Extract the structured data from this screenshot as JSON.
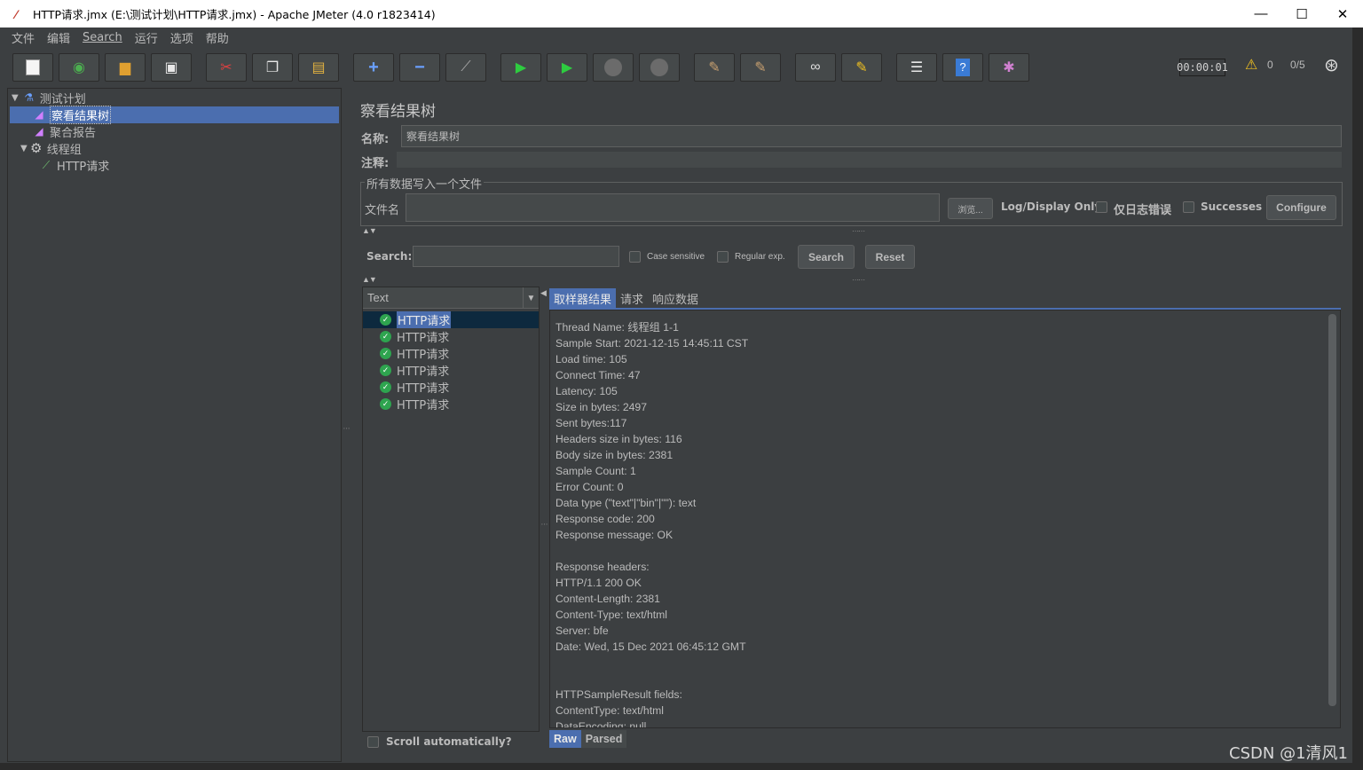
{
  "window": {
    "title": "HTTP请求.jmx (E:\\测试计划\\HTTP请求.jmx) - Apache JMeter (4.0 r1823414)",
    "min": "—",
    "max": "☐",
    "close": "✕"
  },
  "menu": [
    "文件",
    "编辑",
    "Search",
    "运行",
    "选项",
    "帮助"
  ],
  "toolbar": {
    "timer": "00:00:01",
    "warn_count": "0",
    "threads": "0/5"
  },
  "tree": {
    "items": [
      {
        "label": "测试计划"
      },
      {
        "label": "察看结果树"
      },
      {
        "label": "聚合报告"
      },
      {
        "label": "线程组"
      },
      {
        "label": "HTTP请求"
      }
    ]
  },
  "panel": {
    "title": "察看结果树",
    "name_label": "名称:",
    "name_value": "察看结果树",
    "comment_label": "注释:",
    "group_title": "所有数据写入一个文件",
    "file_label": "文件名",
    "browse": "浏览...",
    "log_only": "Log/Display Only:",
    "errors": "仅日志错误",
    "successes": "Successes",
    "configure": "Configure"
  },
  "search": {
    "label": "Search:",
    "case_sensitive": "Case sensitive",
    "regex": "Regular exp.",
    "search_btn": "Search",
    "reset_btn": "Reset"
  },
  "results": {
    "renderer": "Text",
    "rows": [
      "HTTP请求",
      "HTTP请求",
      "HTTP请求",
      "HTTP请求",
      "HTTP请求",
      "HTTP请求"
    ],
    "scroll_auto": "Scroll automatically?"
  },
  "detail": {
    "tabs": [
      "取样器结果",
      "请求",
      "响应数据"
    ],
    "text": "Thread Name: 线程组 1-1\nSample Start: 2021-12-15 14:45:11 CST\nLoad time: 105\nConnect Time: 47\nLatency: 105\nSize in bytes: 2497\nSent bytes:117\nHeaders size in bytes: 116\nBody size in bytes: 2381\nSample Count: 1\nError Count: 0\nData type (\"text\"|\"bin\"|\"\"): text\nResponse code: 200\nResponse message: OK\n\nResponse headers:\nHTTP/1.1 200 OK\nContent-Length: 2381\nContent-Type: text/html\nServer: bfe\nDate: Wed, 15 Dec 2021 06:45:12 GMT\n\n\nHTTPSampleResult fields:\nContentType: text/html\nDataEncoding: null",
    "raw": "Raw",
    "parsed": "Parsed"
  },
  "watermark": "CSDN @1清风1"
}
